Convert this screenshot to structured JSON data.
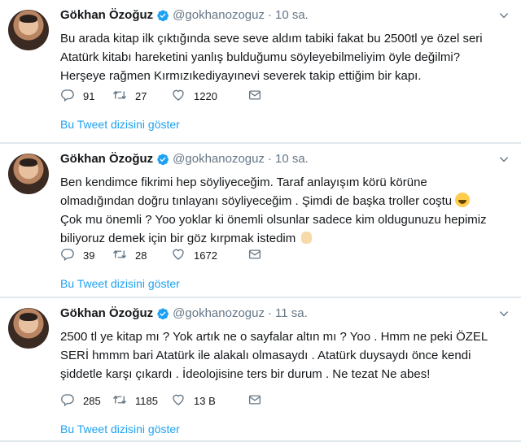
{
  "colors": {
    "link": "#1da1f2",
    "muted": "#657786",
    "text": "#14171a",
    "verified": "#1da1f2"
  },
  "tweets": [
    {
      "name": "Gökhan Özoğuz",
      "handle": "@gokhanozoguz",
      "separator": "·",
      "time": "10 sa.",
      "lines": [
        "Bu arada kitap ilk çıktığında seve seve aldım tabiki fakat bu 2500tl ye özel seri",
        "Atatürk kitabı hareketini yanlış bulduğumu söyleyebilmeliyim öyle değilmi?",
        "Herşeye rağmen Kırmızıkediyayınevi severek takip ettiğim bir kapı."
      ],
      "replies": "91",
      "retweets": "27",
      "likes": "1220",
      "show_thread": "Bu Tweet dizisini göster"
    },
    {
      "name": "Gökhan Özoğuz",
      "handle": "@gokhanozoguz",
      "separator": "·",
      "time": "10 sa.",
      "lines": [
        "Ben kendimce fikrimi hep söyliyeceğim. Taraf anlayışım körü körüne",
        "olmadığından doğru tınlayanı söyliyeceğim . Şimdi de başka troller coştu",
        "Çok mu önemli ? Yoo yoklar ki önemli olsunlar sadece kim oldugunuzu hepimiz",
        "biliyoruz demek için bir göz kırpmak istedim"
      ],
      "replies": "39",
      "retweets": "28",
      "likes": "1672",
      "show_thread": "Bu Tweet dizisini göster"
    },
    {
      "name": "Gökhan Özoğuz",
      "handle": "@gokhanozoguz",
      "separator": "·",
      "time": "11 sa.",
      "lines": [
        "2500 tl ye kitap mı ? Yok artık ne o sayfalar altın mı ? Yoo . Hmm ne peki ÖZEL",
        "SERİ hmmm bari Atatürk ile alakalı olmasaydı . Atatürk duysaydı önce kendi",
        "şiddetle  karşı çıkardı . İdeolojisine ters bir durum . Ne tezat Ne abes!"
      ],
      "replies": "285",
      "retweets": "1185",
      "likes": "13 B",
      "show_thread": "Bu Tweet dizisini göster"
    }
  ],
  "icons": {
    "reply": "reply-icon",
    "retweet": "retweet-icon",
    "like": "heart-icon",
    "dm": "envelope-icon",
    "verified": "verified-badge-icon",
    "more": "chevron-down-icon",
    "emoji_1": "grinning-face-emoji",
    "emoji_2": "waving-hand-emoji"
  }
}
